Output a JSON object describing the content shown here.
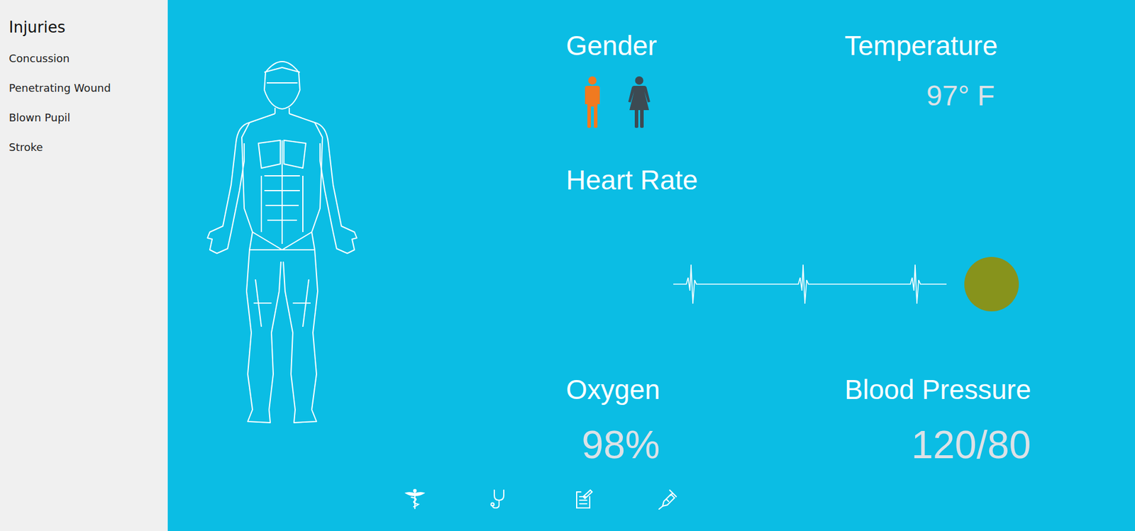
{
  "sidebar": {
    "title": "Injuries",
    "items": [
      {
        "label": "Concussion"
      },
      {
        "label": "Penetrating Wound"
      },
      {
        "label": "Blown Pupil"
      },
      {
        "label": "Stroke"
      }
    ]
  },
  "gender": {
    "label": "Gender",
    "options": [
      {
        "kind": "male",
        "selected": true
      },
      {
        "kind": "female",
        "selected": false
      }
    ]
  },
  "temperature": {
    "label": "Temperature",
    "value": "97° F"
  },
  "heart_rate": {
    "label": "Heart Rate",
    "indicator_color": "#87931c"
  },
  "oxygen": {
    "label": "Oxygen",
    "value": "98%"
  },
  "blood_pressure": {
    "label": "Blood Pressure",
    "value": "120/80"
  },
  "toolbar": [
    {
      "kind": "caduceus"
    },
    {
      "kind": "stethoscope"
    },
    {
      "kind": "clipboard"
    },
    {
      "kind": "syringe"
    }
  ]
}
